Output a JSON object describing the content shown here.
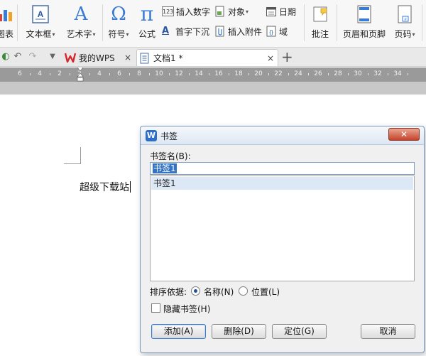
{
  "ribbon": {
    "chart_label": "图表",
    "textbox_label": "文本框",
    "wordart_label": "艺术字",
    "symbol_label": "符号",
    "formula_label": "公式",
    "insert_number_label": "插入数字",
    "dropcap_label": "首字下沉",
    "object_label": "对象",
    "attachment_label": "插入附件",
    "date_label": "日期",
    "field_label": "域",
    "comment_label": "批注",
    "header_footer_label": "页眉和页脚",
    "page_number_label": "页码",
    "omega_glyph": "Ω",
    "pi_glyph": "π",
    "wordart_glyph": "A"
  },
  "tabs": [
    {
      "label": "我的WPS",
      "close": "×"
    },
    {
      "label": "文档1 *",
      "close": "×"
    }
  ],
  "new_tab": "+",
  "ruler": {
    "ticks": [
      "6",
      "4",
      "2",
      "2",
      "4",
      "6",
      "8",
      "10",
      "12",
      "14",
      "16",
      "18",
      "20",
      "22",
      "24",
      "26",
      "28",
      "30",
      "32",
      "34"
    ]
  },
  "document": {
    "text": "超级下载站"
  },
  "dialog": {
    "title": "书签",
    "close_symbol": "✕",
    "name_label": "书签名(B):",
    "name_value": "书签1",
    "list_items": [
      "书签1"
    ],
    "sort_label": "排序依据:",
    "sort_options": [
      {
        "label": "名称(N)",
        "selected": true
      },
      {
        "label": "位置(L)",
        "selected": false
      }
    ],
    "hide_label": "隐藏书签(H)",
    "hide_checked": false,
    "buttons": {
      "add": "添加(A)",
      "delete": "删除(D)",
      "goto": "定位(G)",
      "cancel": "取消"
    }
  },
  "colors": {
    "wps_red": "#d7262b",
    "accent_blue": "#2c6ec9",
    "selection": "#3373c4"
  }
}
